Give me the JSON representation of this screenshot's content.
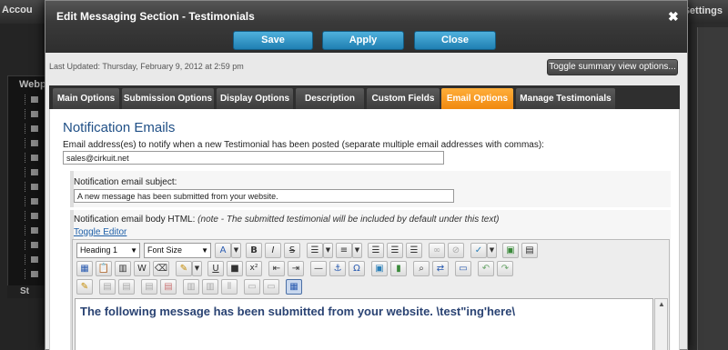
{
  "background": {
    "account_label": "Accou",
    "settings_label": "Settings",
    "panel_title": "Webp",
    "panel_foot": "St"
  },
  "modal": {
    "title": "Edit Messaging Section - Testimonials",
    "close_symbol": "✖",
    "buttons": {
      "save": "Save",
      "apply": "Apply",
      "close": "Close"
    },
    "last_updated": "Last Updated: Thursday, February 9, 2012 at 2:59 pm",
    "toggle_summary": "Toggle summary view options...",
    "tabs": [
      {
        "label": "Main Options",
        "active": false
      },
      {
        "label": "Submission Options",
        "active": false
      },
      {
        "label": "Display Options",
        "active": false
      },
      {
        "label": "Description",
        "active": false
      },
      {
        "label": "Custom Fields",
        "active": false
      },
      {
        "label": "Email Options",
        "active": true
      },
      {
        "label": "Manage Testimonials",
        "active": false
      }
    ]
  },
  "notification": {
    "section_title": "Notification Emails",
    "email_label": "Email address(es) to notify when a new Testimonial has been posted (separate multiple email addresses with commas):",
    "email_value": "sales@cirkuit.net",
    "subject_label": "Notification email subject:",
    "subject_value": "A new message has been submitted from your website.",
    "body_label": "Notification email body HTML:",
    "body_note": "(note - The submitted testimonial will be included by default under this text)",
    "toggle_editor": "Toggle Editor"
  },
  "editor": {
    "format_select": "Heading 1",
    "fontsize_select": "Font Size",
    "body_text": "The following message has been submitted from your website. \\test\"ing'here\\"
  },
  "colors": {
    "accent_tab": "#f0890f",
    "button_blue": "#1f7fb2",
    "title_blue": "#1f4f86"
  }
}
